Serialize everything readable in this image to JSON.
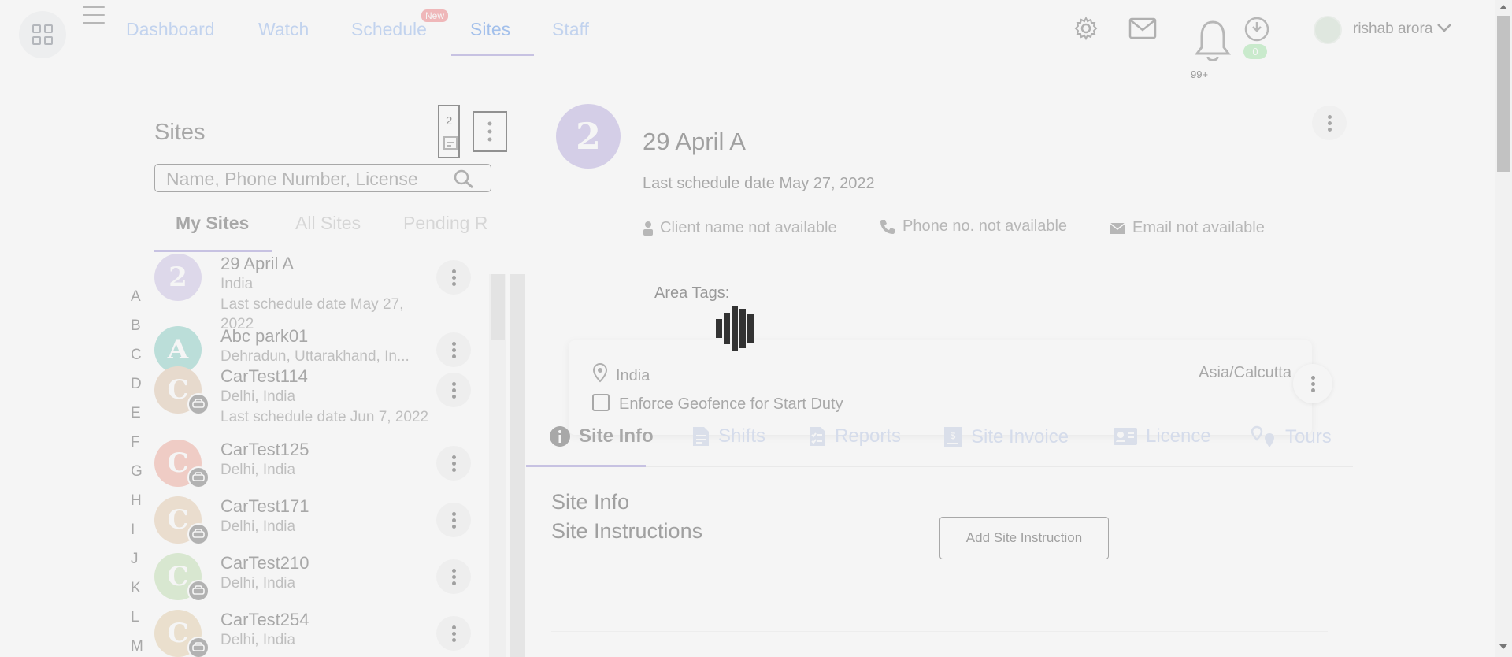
{
  "topbar": {
    "nav": [
      {
        "label": "Dashboard"
      },
      {
        "label": "Watch"
      },
      {
        "label": "Schedule",
        "badge": "New"
      },
      {
        "label": "Sites",
        "active": true
      },
      {
        "label": "Staff"
      }
    ],
    "download_count": "0",
    "notification_count": "99+",
    "user_name": "rishab arora",
    "icons": [
      "apps-icon",
      "hamburger-icon",
      "gear-icon",
      "mail-icon",
      "bell-icon",
      "download-clock-icon",
      "avatar-icon",
      "chevron-down-icon"
    ]
  },
  "sites_panel": {
    "title": "Sites",
    "badge_value": "2",
    "search_placeholder": "Name, Phone Number, License",
    "tabs": [
      {
        "label": "My Sites",
        "active": true
      },
      {
        "label": "All Sites"
      },
      {
        "label": "Pending R"
      }
    ],
    "letters": [
      "A",
      "B",
      "C",
      "D",
      "E",
      "F",
      "G",
      "H",
      "I",
      "J",
      "K",
      "L",
      "M"
    ],
    "sites": [
      {
        "initial": "2",
        "name": "29 April A",
        "location": "India",
        "extra": "Last schedule date May 27, 2022",
        "color": "#cbbfe6",
        "car": false
      },
      {
        "initial": "A",
        "name": "Abc park01",
        "location": "Dehradun, Uttarakhand, In...",
        "extra": "",
        "color": "#7fcdc0",
        "car": false
      },
      {
        "initial": "C",
        "name": "CarTest114",
        "location": "Delhi, India",
        "extra": "Last schedule date Jun 7, 2022",
        "color": "#e0c3a6",
        "car": true
      },
      {
        "initial": "C",
        "name": "CarTest125",
        "location": "Delhi, India",
        "extra": "",
        "color": "#f2a596",
        "car": true
      },
      {
        "initial": "C",
        "name": "CarTest171",
        "location": "Delhi, India",
        "extra": "",
        "color": "#e6c9a8",
        "car": true
      },
      {
        "initial": "C",
        "name": "CarTest210",
        "location": "Delhi, India",
        "extra": "",
        "color": "#bfe0ad",
        "car": true
      },
      {
        "initial": "C",
        "name": "CarTest254",
        "location": "Delhi, India",
        "extra": "",
        "color": "#e6cfa6",
        "car": true
      }
    ]
  },
  "detail": {
    "initial": "2",
    "title": "29 April A",
    "last_schedule": "Last schedule date May 27, 2022",
    "client": "Client name not available",
    "phone": "Phone no. not available",
    "email": "Email not available",
    "area_tags_label": "Area Tags:",
    "country": "India",
    "timezone": "Asia/Calcutta",
    "geofence_label": "Enforce Geofence for Start Duty",
    "tabs": [
      {
        "label": "Site Info",
        "icon": "info-icon",
        "active": true
      },
      {
        "label": "Shifts",
        "icon": "document-icon"
      },
      {
        "label": "Reports",
        "icon": "checklist-icon"
      },
      {
        "label": "Site Invoice",
        "icon": "invoice-icon"
      },
      {
        "label": "Licence",
        "icon": "id-card-icon"
      },
      {
        "label": "Tours",
        "icon": "map-pins-icon"
      }
    ],
    "section_title": "Site Info",
    "instructions_title": "Site Instructions",
    "add_instruction_label": "Add Site Instruction"
  }
}
